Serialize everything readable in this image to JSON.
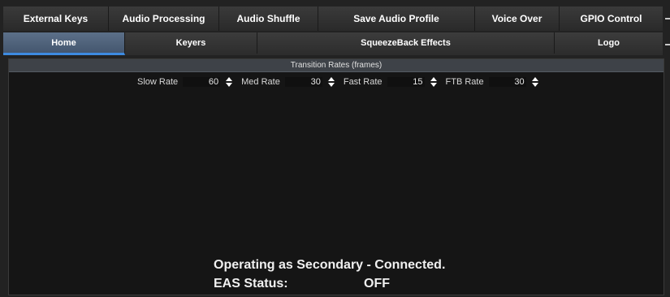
{
  "tabs_primary": [
    {
      "label": "External Keys"
    },
    {
      "label": "Audio Processing"
    },
    {
      "label": "Audio Shuffle"
    },
    {
      "label": "Save Audio Profile"
    },
    {
      "label": "Voice Over"
    },
    {
      "label": "GPIO Control"
    }
  ],
  "tabs_secondary": [
    {
      "label": "Home",
      "active": true
    },
    {
      "label": "Keyers"
    },
    {
      "label": "SqueezeBack Effects"
    },
    {
      "label": "Logo"
    }
  ],
  "transition": {
    "header": "Transition Rates (frames)",
    "rates": [
      {
        "label": "Slow Rate",
        "value": "60"
      },
      {
        "label": "Med Rate",
        "value": "30"
      },
      {
        "label": "Fast Rate",
        "value": "15"
      },
      {
        "label": "FTB Rate",
        "value": "30"
      }
    ]
  },
  "status": {
    "operating": "Operating as Secondary - Connected.",
    "eas_label": "EAS Status:",
    "eas_value": "OFF"
  },
  "colors": {
    "active_tab_underline": "#3d8be0",
    "active_tab_bg": "#5c7089"
  },
  "icons": {
    "spinner": "up-down-spinner-icon"
  }
}
